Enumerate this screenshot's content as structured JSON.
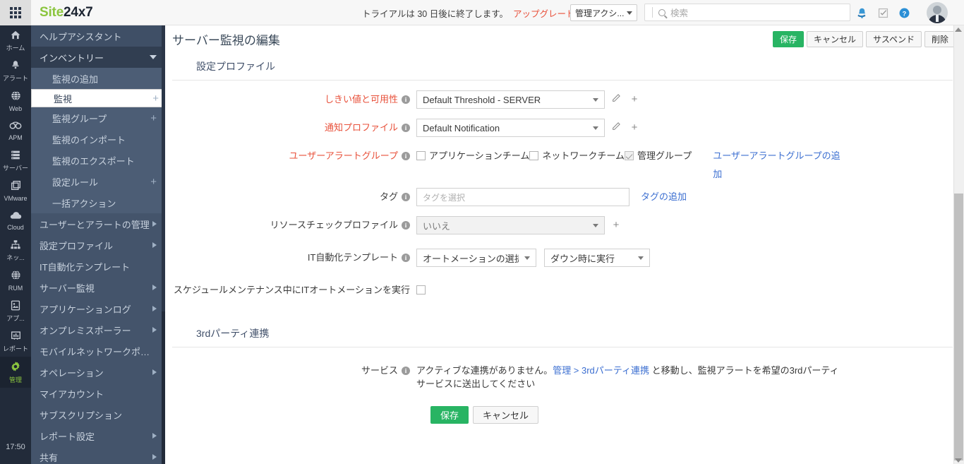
{
  "topbar": {
    "waffle_icon": "apps-grid-icon",
    "brand_green": "Site",
    "brand_dark": "24x7",
    "trial_text": "トライアルは 30 日後に終了します。",
    "trial_link": "アップグレード実行",
    "account_selector": "管理アクシ...",
    "search_placeholder": "検索",
    "icons": [
      "notification-bell-icon",
      "tasks-icon",
      "help-icon"
    ],
    "help_glyph": "?",
    "avatar": "user-avatar"
  },
  "rail": {
    "items": [
      {
        "label": "ホーム",
        "glyph": "⌂",
        "icon": "home-icon",
        "active": false
      },
      {
        "label": "アラート",
        "glyph": "🔔",
        "icon": "alert-bell-icon",
        "active": false
      },
      {
        "label": "Web",
        "glyph": "🌐",
        "icon": "web-globe-icon",
        "active": false
      },
      {
        "label": "APM",
        "glyph": "👓",
        "icon": "apm-icon",
        "active": false
      },
      {
        "label": "サーバー",
        "glyph": "▤",
        "icon": "server-stack-icon",
        "active": false
      },
      {
        "label": "VMware",
        "glyph": "❐",
        "icon": "vmware-icon",
        "active": false
      },
      {
        "label": "Cloud",
        "glyph": "☁",
        "icon": "cloud-icon",
        "active": false
      },
      {
        "label": "ネッ...",
        "glyph": "⛬",
        "icon": "network-icon",
        "active": false
      },
      {
        "label": "RUM",
        "glyph": "◍",
        "icon": "rum-globe-icon",
        "active": false
      },
      {
        "label": "アプ...",
        "glyph": "▣",
        "icon": "mobile-app-icon",
        "active": false
      },
      {
        "label": "レポート",
        "glyph": "▧",
        "icon": "reports-icon",
        "active": false
      },
      {
        "label": "管理",
        "glyph": "✿",
        "icon": "admin-gear-icon",
        "active": true
      }
    ],
    "clock": "17:50"
  },
  "sidebar": {
    "help_assistant": "ヘルプアシスタント",
    "inventory": "インベントリー",
    "sub_items": [
      {
        "label": "監視の追加",
        "plus": false,
        "selected": false
      },
      {
        "label": "監視",
        "plus": true,
        "selected": true
      },
      {
        "label": "監視グループ",
        "plus": true,
        "selected": false
      },
      {
        "label": "監視のインポート",
        "plus": false,
        "selected": false
      },
      {
        "label": "監視のエクスポート",
        "plus": false,
        "selected": false
      },
      {
        "label": "設定ルール",
        "plus": true,
        "selected": false
      },
      {
        "label": "一括アクション",
        "plus": false,
        "selected": false
      }
    ],
    "items": [
      {
        "label": "ユーザーとアラートの管理",
        "arrow": true
      },
      {
        "label": "設定プロファイル",
        "arrow": true
      },
      {
        "label": "IT自動化テンプレート",
        "arrow": false
      },
      {
        "label": "サーバー監視",
        "arrow": true
      },
      {
        "label": "アプリケーションログ",
        "arrow": true
      },
      {
        "label": "オンプレミスポーラー",
        "arrow": true
      },
      {
        "label": "モバイルネットワークポー...",
        "arrow": false
      },
      {
        "label": "オペレーション",
        "arrow": true
      },
      {
        "label": "マイアカウント",
        "arrow": false
      },
      {
        "label": "サブスクリプション",
        "arrow": false
      },
      {
        "label": "レポート設定",
        "arrow": true
      },
      {
        "label": "共有",
        "arrow": true
      }
    ]
  },
  "page": {
    "title": "サーバー監視の編集",
    "header_buttons": [
      {
        "label": "保存",
        "primary": true,
        "name": "save-button"
      },
      {
        "label": "キャンセル",
        "primary": false,
        "name": "cancel-button"
      },
      {
        "label": "サスペンド",
        "primary": false,
        "name": "suspend-button"
      },
      {
        "label": "削除",
        "primary": false,
        "name": "delete-button"
      }
    ],
    "section1_title": "設定プロファイル",
    "section2_title": "3rdパーティ連携",
    "fields": {
      "threshold": {
        "label": "しきい値と可用性",
        "value": "Default Threshold - SERVER"
      },
      "notification": {
        "label": "通知プロファイル",
        "value": "Default Notification"
      },
      "user_alert_group": {
        "label": "ユーザーアラートグループ",
        "checkboxes": [
          {
            "label": "アプリケーションチーム",
            "checked": false
          },
          {
            "label": "ネットワークチーム",
            "checked": false
          },
          {
            "label": "管理グループ",
            "checked": true
          }
        ],
        "add_link": "ユーザーアラートグループの追加"
      },
      "tag": {
        "label": "タグ",
        "placeholder": "タグを選択",
        "add_link": "タグの追加"
      },
      "resource_check": {
        "label": "リソースチェックプロファイル",
        "value": "いいえ"
      },
      "it_automation": {
        "label": "IT自動化テンプレート",
        "value1": "オートメーションの選択",
        "value2": "ダウン時に実行"
      },
      "maintenance_automation": {
        "label": "スケジュールメンテナンス中にITオートメーションを実行",
        "checked": false
      },
      "service": {
        "label": "サービス",
        "text_before": "アクティブな連携がありません。",
        "link": "管理 > 3rdパーティ連携",
        "text_after": " と移動し、監視アラートを希望の3rdパーティサービスに送出してください"
      }
    },
    "bottom_buttons": [
      {
        "label": "保存",
        "primary": true,
        "name": "save-button-bottom"
      },
      {
        "label": "キャンセル",
        "primary": false,
        "name": "cancel-button-bottom"
      }
    ]
  },
  "colors": {
    "brand_green": "#8bc53f",
    "primary_green": "#28b463",
    "accent_red": "#e8503a",
    "link_blue": "#3c6fd1",
    "rail_bg": "#222b3a",
    "sidebar_bg": "#44546b"
  }
}
